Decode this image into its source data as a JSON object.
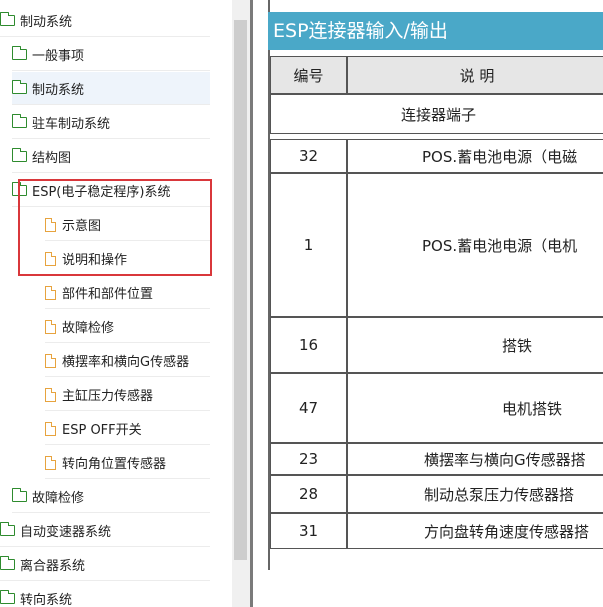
{
  "tree": {
    "items": [
      {
        "label": "制动系统",
        "icon": "folder-icon",
        "level": 0
      },
      {
        "label": "一般事项",
        "icon": "folder-icon",
        "level": 1
      },
      {
        "label": "制动系统",
        "icon": "folder-icon",
        "level": 1,
        "selected": true
      },
      {
        "label": "驻车制动系统",
        "icon": "folder-icon",
        "level": 1
      },
      {
        "label": "结构图",
        "icon": "folder-icon",
        "level": 1
      },
      {
        "label": "ESP(电子稳定程序)系统",
        "icon": "folder-icon",
        "level": 1
      },
      {
        "label": "示意图",
        "icon": "document-icon",
        "level": 2
      },
      {
        "label": "说明和操作",
        "icon": "document-icon",
        "level": 2
      },
      {
        "label": "部件和部件位置",
        "icon": "document-icon",
        "level": 2
      },
      {
        "label": "故障检修",
        "icon": "document-icon",
        "level": 2
      },
      {
        "label": "横摆率和横向G传感器",
        "icon": "document-icon",
        "level": 2
      },
      {
        "label": "主缸压力传感器",
        "icon": "document-icon",
        "level": 2
      },
      {
        "label": "ESP OFF开关",
        "icon": "document-icon",
        "level": 2
      },
      {
        "label": "转向角位置传感器",
        "icon": "document-icon",
        "level": 2
      },
      {
        "label": "故障检修",
        "icon": "folder-icon",
        "level": 1
      },
      {
        "label": "自动变速器系统",
        "icon": "folder-icon",
        "level": 0
      },
      {
        "label": "离合器系统",
        "icon": "folder-icon",
        "level": 0
      },
      {
        "label": "转向系统",
        "icon": "folder-icon",
        "level": 0
      }
    ]
  },
  "document": {
    "title": "ESP连接器输入/输出",
    "table": {
      "headers": {
        "number": "编号",
        "description": "说 明"
      },
      "section": "连接器端子",
      "rows": [
        {
          "number": "32",
          "description": "POS.蓄电池电源（电磁"
        },
        {
          "number": "1",
          "description": "POS.蓄电池电源（电机"
        },
        {
          "number": "16",
          "description": "搭铁"
        },
        {
          "number": "47",
          "description": "电机搭铁"
        },
        {
          "number": "23",
          "description": "横摆率与横向G传感器搭"
        },
        {
          "number": "28",
          "description": "制动总泵压力传感器搭"
        },
        {
          "number": "31",
          "description": "方向盘转角速度传感器搭"
        }
      ]
    }
  },
  "colors": {
    "title_bar": "#4aa8c8",
    "folder": "#2e8b2e",
    "document": "#e7a33e",
    "highlight": "#d9373b",
    "selected_row": "#eef4fb"
  }
}
